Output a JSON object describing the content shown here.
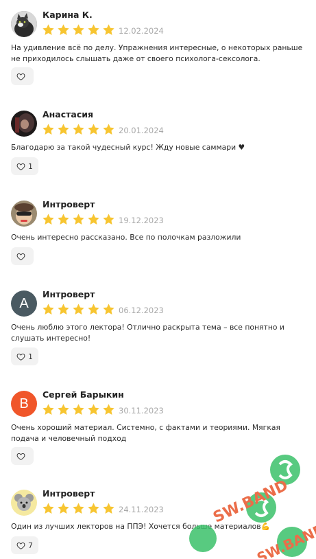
{
  "reviews": [
    {
      "name": "Карина К.",
      "date": "12.02.2024",
      "text": "На удивление всё по делу. Упражнения интересные, о некоторых раньше не приходилось слышать даже от своего психолога-сексолога.",
      "likes": "",
      "avatar": {
        "type": "photo",
        "color": "#6d6d6d"
      }
    },
    {
      "name": "Анастасия",
      "date": "20.01.2024",
      "text": "Благодарю за такой чудесный курс! Жду новые саммари ♥",
      "likes": "1",
      "avatar": {
        "type": "photo",
        "color": "#3a2a2a"
      }
    },
    {
      "name": "Интроверт",
      "date": "19.12.2023",
      "text": "Очень интересно рассказано. Все по полочкам разложили",
      "likes": "",
      "avatar": {
        "type": "photo",
        "color": "#8a6a4a"
      }
    },
    {
      "name": "Интроверт",
      "date": "06.12.2023",
      "text": "Очень люблю этого лектора! Отлично раскрыта тема – все понятно и слушать интересно!",
      "likes": "1",
      "avatar": {
        "type": "letter",
        "letter": "A",
        "color": "#4a5a62"
      }
    },
    {
      "name": "Сергей Барыкин",
      "date": "30.11.2023",
      "text": "Очень хороший материал. Системно, с фактами и теориями. Мягкая подача и человечный подход",
      "likes": "",
      "avatar": {
        "type": "letter",
        "letter": "B",
        "color": "#f0562a"
      }
    },
    {
      "name": "Интроверт",
      "date": "24.11.2023",
      "text": "Один из лучших лекторов на ППЭ! Хочется больше материалов💪",
      "likes": "7",
      "avatar": {
        "type": "photo",
        "color": "#f5e9a0"
      }
    }
  ],
  "rating": {
    "stars": 5,
    "max": 5
  },
  "colors": {
    "star": "#f7c531",
    "date": "#a8a8a8",
    "like_bg": "#f2f2f2"
  },
  "icons": {
    "like": "heart-outline-icon"
  },
  "watermark": {
    "text": "SW.BAND"
  }
}
